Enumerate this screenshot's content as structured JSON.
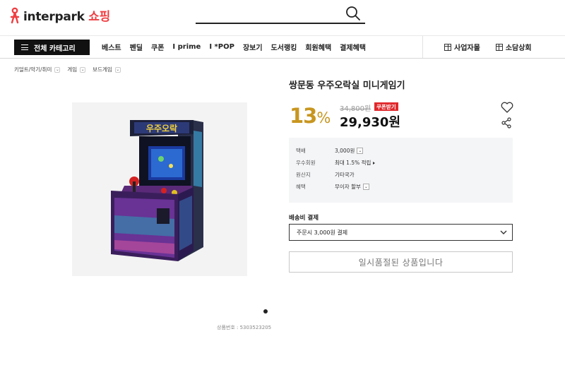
{
  "header": {
    "logo_text": "interpark",
    "logo_shop": "쇼핑",
    "search_placeholder": ""
  },
  "nav": {
    "category_button": "전체 카테고리",
    "links": [
      "베스트",
      "펜딜",
      "쿠폰",
      "I prime",
      "I *POP",
      "장보기",
      "도서랭킹",
      "회원혜택",
      "결제혜택"
    ],
    "right_items": [
      "사업자몰",
      "소담상회"
    ]
  },
  "breadcrumb": [
    "키덜트/악기/취미",
    "게임",
    "보드게임"
  ],
  "product": {
    "title": "쌍문동 우주오락실 미니게임기",
    "discount": "13",
    "discount_unit": "%",
    "original_price": "34,800원",
    "coupon_label": "쿠폰받기",
    "sale_price": "29,930원",
    "product_code": "상품번호 : 5303523205",
    "image_count": 1
  },
  "info": {
    "rows": [
      {
        "label": "택배",
        "value": "3,000원"
      },
      {
        "label": "우수회원",
        "value": "최대 1.5% 적립"
      },
      {
        "label": "원산지",
        "value": "기타국가"
      },
      {
        "label": "혜택",
        "value": "무이자 할부"
      }
    ]
  },
  "shipping": {
    "label": "배송비 결제",
    "selected": "주문시 3,000원 결제"
  },
  "soldout_text": "일시품절된 상품입니다",
  "colors": {
    "accent": "#ef3e42",
    "discount": "#c8961f",
    "coupon_bg": "#e0282c"
  }
}
